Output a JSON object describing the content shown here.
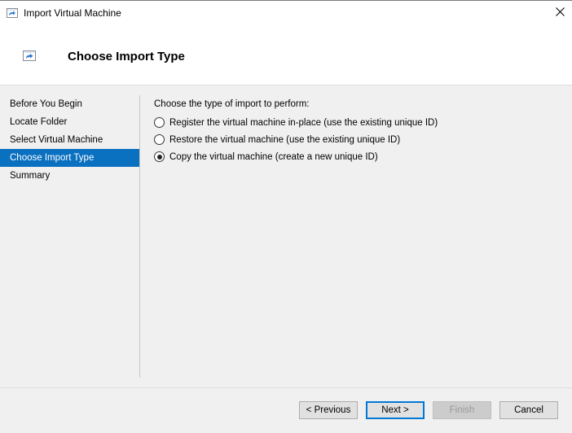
{
  "window": {
    "title": "Import Virtual Machine",
    "icon": "import-vm-icon",
    "close_icon": "close-icon"
  },
  "header": {
    "title": "Choose Import Type",
    "icon": "import-vm-icon"
  },
  "sidebar": {
    "items": [
      {
        "label": "Before You Begin",
        "active": false
      },
      {
        "label": "Locate Folder",
        "active": false
      },
      {
        "label": "Select Virtual Machine",
        "active": false
      },
      {
        "label": "Choose Import Type",
        "active": true
      },
      {
        "label": "Summary",
        "active": false
      }
    ]
  },
  "main": {
    "prompt": "Choose the type of import to perform:",
    "options": [
      {
        "label": "Register the virtual machine in-place (use the existing unique ID)",
        "checked": false
      },
      {
        "label": "Restore the virtual machine (use the existing unique ID)",
        "checked": false
      },
      {
        "label": "Copy the virtual machine (create a new unique ID)",
        "checked": true
      }
    ]
  },
  "footer": {
    "previous_label": "< Previous",
    "next_label": "Next >",
    "finish_label": "Finish",
    "cancel_label": "Cancel"
  },
  "colors": {
    "accent": "#0a70c0",
    "default_button_border": "#0078d7"
  }
}
